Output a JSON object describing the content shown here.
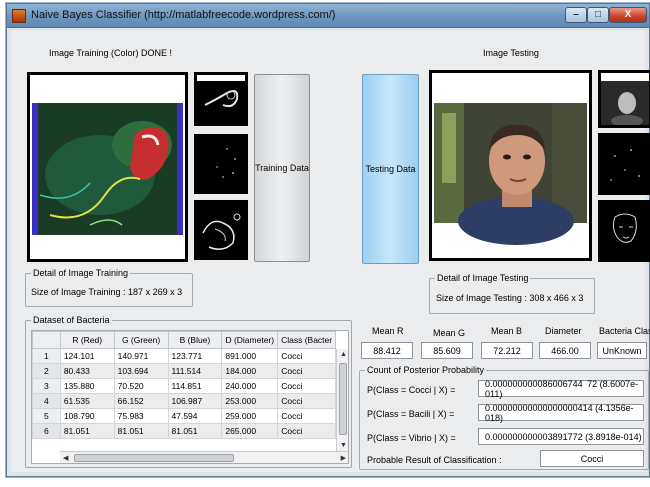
{
  "window": {
    "title": "Naive Bayes Classifier (http://matlabfreecode.wordpress.com/)",
    "minimize_glyph": "–",
    "maximize_glyph": "□",
    "close_glyph": "X"
  },
  "training": {
    "status_label": "Image Training (Color) DONE !",
    "button_label": "Training Data",
    "detail_legend": "Detail of Image Training",
    "size_text": "Size of Image Training :   187 x 269 x 3"
  },
  "testing": {
    "title_label": "Image Testing",
    "button_label": "Testing Data",
    "detail_legend": "Detail of Image Testing",
    "size_text": "Size of Image Testing :  308 x 466 x 3"
  },
  "dataset": {
    "legend": "Dataset of  Bacteria",
    "columns": [
      "R (Red)",
      "G (Green)",
      "B (Blue)",
      "D (Diameter)",
      "Class (Bacter"
    ],
    "rows": [
      {
        "n": "1",
        "r": "124.101",
        "g": "140.971",
        "b": "123.771",
        "d": "891.000",
        "c": "Cocci"
      },
      {
        "n": "2",
        "r": "80.433",
        "g": "103.694",
        "b": "111.514",
        "d": "184.000",
        "c": "Cocci"
      },
      {
        "n": "3",
        "r": "135.880",
        "g": "70.520",
        "b": "114.851",
        "d": "240.000",
        "c": "Cocci"
      },
      {
        "n": "4",
        "r": "61.535",
        "g": "66.152",
        "b": "106.987",
        "d": "253.000",
        "c": "Cocci"
      },
      {
        "n": "5",
        "r": "108.790",
        "g": "75.983",
        "g2": "",
        "b": "47.594",
        "d": "259.000",
        "c": "Cocci"
      },
      {
        "n": "6",
        "r": "81.051",
        "g": "81.051",
        "b": "81.051",
        "d": "265.000",
        "c": "Cocci"
      }
    ]
  },
  "stats": {
    "headers": [
      "Mean R",
      "Mean G",
      "Mean B",
      "Diameter",
      "Bacteria Class"
    ],
    "values": [
      "88.412",
      "85.609",
      "72.212",
      "466.00",
      "UnKnown"
    ]
  },
  "posterior": {
    "legend": "Count of  Posterior Probability",
    "items": [
      {
        "label": "P(Class = Cocci | X) =",
        "value": "0.000000000086006744 72  (8.6007e-011)"
      },
      {
        "label": "P(Class = Bacili | X) =",
        "value": "0.00000000000000000414  (4.1356e-018)"
      },
      {
        "label": "P(Class = Vibrio | X) =",
        "value": "0.000000000003891772  (3.8918e-014)"
      }
    ],
    "result_label": "Probable Result of Classification  :",
    "result_value": "Cocci"
  },
  "colors": {
    "titlebar": "#6d96bf",
    "testing_button": "#b9e0f8",
    "panel": "#ebeced"
  }
}
